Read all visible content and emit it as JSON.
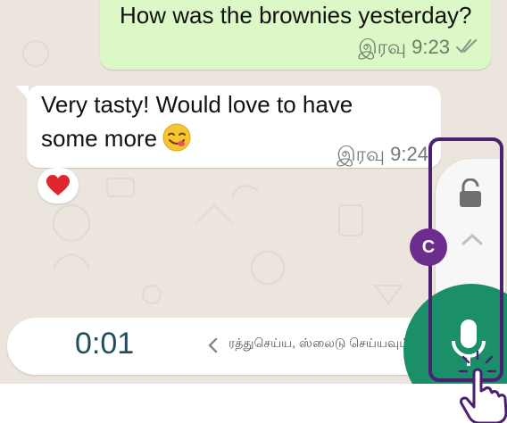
{
  "messages": {
    "outgoing": {
      "text": "How was the brownies yesterday?",
      "time": "இரவு 9:23",
      "status_icon": "double-check-icon"
    },
    "incoming": {
      "line1": "Very tasty! Would love to have",
      "line2": "some more",
      "emoji": "😋",
      "time": "இரவு 9:24",
      "reaction": "❤️"
    }
  },
  "recording": {
    "timer": "0:01",
    "slide_hint": "ரத்துசெய்ய, ஸ்லைடு செய்யவும்",
    "lock_icon": "unlock-icon",
    "swipe_up_icon": "chevron-up-icon",
    "mic_icon": "microphone-icon"
  },
  "annotation": {
    "badge": "C"
  },
  "colors": {
    "chat_bg": "#ece5dd",
    "outgoing_bubble": "#dcf8c6",
    "mic_green": "#1b8f67",
    "highlight_purple": "#4a2170",
    "badge_purple": "#6d2d8e",
    "tick_color": "#8a9a8a"
  }
}
